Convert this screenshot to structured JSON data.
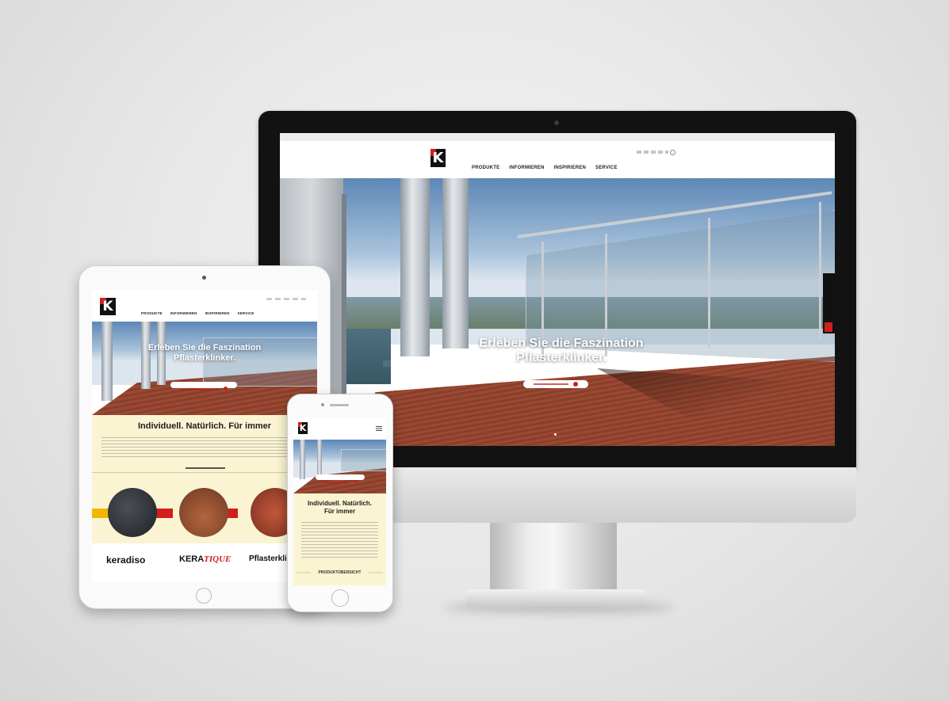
{
  "desktop": {
    "nav": [
      "PRODUKTE",
      "INFORMIEREN",
      "INSPIRIEREN",
      "SERVICE"
    ],
    "hero_title_line1": "Erleben Sie die Faszination",
    "hero_title_line2": "Pflasterklinker."
  },
  "tablet": {
    "nav": [
      "PRODUKTE",
      "INFORMIEREN",
      "INSPIRIEREN",
      "SERVICE"
    ],
    "hero_title_line1": "Erleben Sie die Faszination",
    "hero_title_line2": "Pflasterklinker.",
    "section_title": "Individuell. Natürlich. Für immer",
    "brands": [
      "keradiso",
      "KERA",
      "TIQUE",
      "Pflasterkli"
    ]
  },
  "phone": {
    "section_title_line1": "Individuell. Natürlich.",
    "section_title_line2": "Für immer",
    "link_label": "PRODUKTÜBERSICHT"
  },
  "colors": {
    "brand_red": "#d21d1d",
    "brand_black": "#111111",
    "cream": "#faf4d2",
    "accent_yellow": "#f2b705"
  }
}
